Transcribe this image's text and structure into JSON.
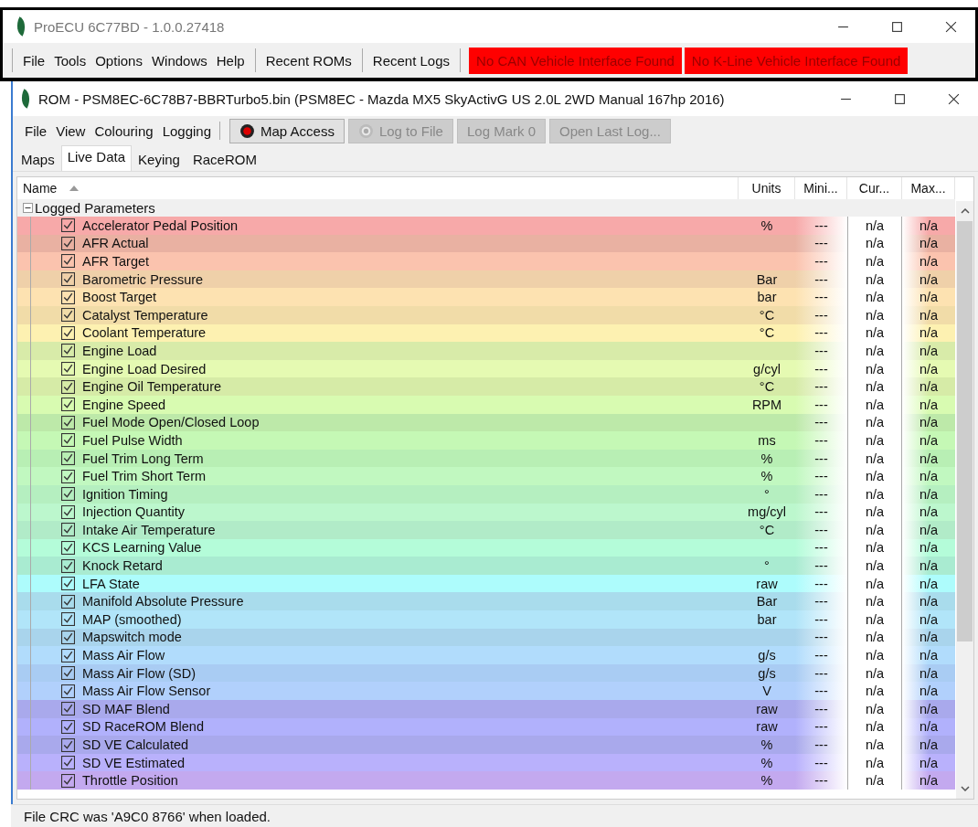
{
  "app_window": {
    "title": "ProECU 6C77BD - 1.0.0.27418",
    "menu": [
      "File",
      "Tools",
      "Options",
      "Windows",
      "Help"
    ],
    "menu_buttons": [
      "Recent ROMs",
      "Recent Logs"
    ],
    "alerts": [
      "No CAN Vehicle Interface Found",
      "No K-Line Vehicle Interface Found"
    ]
  },
  "rom_window": {
    "title": "ROM - PSM8EC-6C78B7-BBRTurbo5.bin (PSM8EC - Mazda MX5 SkyActivG US 2.0L 2WD Manual 167hp 2016)",
    "menu": [
      "File",
      "View",
      "Colouring",
      "Logging"
    ],
    "toolbar": [
      {
        "label": "Map Access",
        "kind": "record",
        "disabled": false
      },
      {
        "label": "Log to File",
        "kind": "disc",
        "disabled": true
      },
      {
        "label": "Log Mark 0",
        "kind": "plain",
        "disabled": true
      },
      {
        "label": "Open Last Log...",
        "kind": "plain",
        "disabled": true
      }
    ],
    "tabs": [
      {
        "label": "Maps",
        "selected": false
      },
      {
        "label": "Live Data",
        "selected": true
      },
      {
        "label": "Keying",
        "selected": false
      },
      {
        "label": "RaceROM",
        "selected": false
      }
    ],
    "table": {
      "columns": [
        "Name",
        "Units",
        "Mini...",
        "Cur...",
        "Max..."
      ],
      "groups": [
        {
          "label": "Logged Parameters",
          "expanded": true,
          "children": [
            {
              "name": "Accelerator Pedal Position",
              "units": "%",
              "minimum": "---",
              "current": "n/a",
              "maximum": "n/a",
              "checked": true,
              "color": "#f7a9a9"
            },
            {
              "name": "AFR Actual",
              "minimum": "---",
              "current": "n/a",
              "maximum": "n/a",
              "checked": true,
              "color": "#e9b1a2"
            },
            {
              "name": "AFR Target",
              "minimum": "---",
              "current": "n/a",
              "maximum": "n/a",
              "checked": true,
              "color": "#fbc3ae"
            },
            {
              "name": "Barometric Pressure",
              "units": "Bar",
              "minimum": "---",
              "current": "n/a",
              "maximum": "n/a",
              "checked": true,
              "color": "#efd0a9"
            },
            {
              "name": "Boost Target",
              "units": "bar",
              "minimum": "---",
              "current": "n/a",
              "maximum": "n/a",
              "checked": true,
              "color": "#fde2b1"
            },
            {
              "name": "Catalyst Temperature",
              "units": "°C",
              "minimum": "---",
              "current": "n/a",
              "maximum": "n/a",
              "checked": true,
              "color": "#f1dca8"
            },
            {
              "name": "Coolant Temperature",
              "units": "°C",
              "minimum": "---",
              "current": "n/a",
              "maximum": "n/a",
              "checked": true,
              "color": "#fdf1b1"
            },
            {
              "name": "Engine Load",
              "minimum": "---",
              "current": "n/a",
              "maximum": "n/a",
              "checked": true,
              "color": "#d8eba9"
            },
            {
              "name": "Engine Load Desired",
              "units": "g/cyl",
              "minimum": "---",
              "current": "n/a",
              "maximum": "n/a",
              "checked": true,
              "color": "#e5fab2"
            },
            {
              "name": "Engine Oil Temperature",
              "units": "°C",
              "minimum": "---",
              "current": "n/a",
              "maximum": "n/a",
              "checked": true,
              "color": "#d6eba7"
            },
            {
              "name": "Engine Speed",
              "units": "RPM",
              "minimum": "---",
              "current": "n/a",
              "maximum": "n/a",
              "checked": true,
              "color": "#d8fbb1"
            },
            {
              "name": "Fuel Mode Open/Closed Loop",
              "minimum": "---",
              "current": "n/a",
              "maximum": "n/a",
              "checked": true,
              "color": "#bde9a9"
            },
            {
              "name": "Fuel Pulse Width",
              "units": "ms",
              "minimum": "---",
              "current": "n/a",
              "maximum": "n/a",
              "checked": true,
              "color": "#c5f8b5"
            },
            {
              "name": "Fuel Trim Long Term",
              "units": "%",
              "minimum": "---",
              "current": "n/a",
              "maximum": "n/a",
              "checked": true,
              "color": "#b8efb4"
            },
            {
              "name": "Fuel Trim Short Term",
              "units": "%",
              "minimum": "---",
              "current": "n/a",
              "maximum": "n/a",
              "checked": true,
              "color": "#c1f8c0"
            },
            {
              "name": "Ignition Timing",
              "units": "°",
              "minimum": "---",
              "current": "n/a",
              "maximum": "n/a",
              "checked": true,
              "color": "#b5efc0"
            },
            {
              "name": "Injection Quantity",
              "units": "mg/cyl",
              "minimum": "---",
              "current": "n/a",
              "maximum": "n/a",
              "checked": true,
              "color": "#bcf7cd"
            },
            {
              "name": "Intake Air Temperature",
              "units": "°C",
              "minimum": "---",
              "current": "n/a",
              "maximum": "n/a",
              "checked": true,
              "color": "#b1ebc8"
            },
            {
              "name": "KCS Learning Value",
              "minimum": "---",
              "current": "n/a",
              "maximum": "n/a",
              "checked": true,
              "color": "#b4fcd9"
            },
            {
              "name": "Knock Retard",
              "units": "°",
              "minimum": "---",
              "current": "n/a",
              "maximum": "n/a",
              "checked": true,
              "color": "#a9ebd1"
            },
            {
              "name": "LFA State",
              "units": "raw",
              "minimum": "---",
              "current": "n/a",
              "maximum": "n/a",
              "checked": true,
              "color": "#adfcfc"
            },
            {
              "name": "Manifold Absolute Pressure",
              "units": "Bar",
              "minimum": "---",
              "current": "n/a",
              "maximum": "n/a",
              "checked": true,
              "color": "#a9dcec"
            },
            {
              "name": "MAP (smoothed)",
              "units": "bar",
              "minimum": "---",
              "current": "n/a",
              "maximum": "n/a",
              "checked": true,
              "color": "#b1e5f9"
            },
            {
              "name": "Mapswitch mode",
              "minimum": "---",
              "current": "n/a",
              "maximum": "n/a",
              "checked": true,
              "color": "#a9d4ec"
            },
            {
              "name": "Mass Air Flow",
              "units": "g/s",
              "minimum": "---",
              "current": "n/a",
              "maximum": "n/a",
              "checked": true,
              "color": "#b1dcfc"
            },
            {
              "name": "Mass Air Flow (SD)",
              "units": "g/s",
              "minimum": "---",
              "current": "n/a",
              "maximum": "n/a",
              "checked": true,
              "color": "#a9ccf3"
            },
            {
              "name": "Mass Air Flow Sensor",
              "units": "V",
              "minimum": "---",
              "current": "n/a",
              "maximum": "n/a",
              "checked": true,
              "color": "#b1d0fc"
            },
            {
              "name": "SD MAF Blend",
              "units": "raw",
              "minimum": "---",
              "current": "n/a",
              "maximum": "n/a",
              "checked": true,
              "color": "#a9a9ec"
            },
            {
              "name": "SD RaceROM Blend",
              "units": "raw",
              "minimum": "---",
              "current": "n/a",
              "maximum": "n/a",
              "checked": true,
              "color": "#b1b1fc"
            },
            {
              "name": "SD VE Calculated",
              "units": "%",
              "minimum": "---",
              "current": "n/a",
              "maximum": "n/a",
              "checked": true,
              "color": "#a9a9ec"
            },
            {
              "name": "SD VE Estimated",
              "units": "%",
              "minimum": "---",
              "current": "n/a",
              "maximum": "n/a",
              "checked": true,
              "color": "#b9b1fc"
            },
            {
              "name": "Throttle Position",
              "units": "%",
              "minimum": "---",
              "current": "n/a",
              "maximum": "n/a",
              "checked": true,
              "color": "#c3a9ef"
            }
          ]
        }
      ]
    }
  },
  "status_bar": "File CRC was 'A9C0 8766' when loaded."
}
